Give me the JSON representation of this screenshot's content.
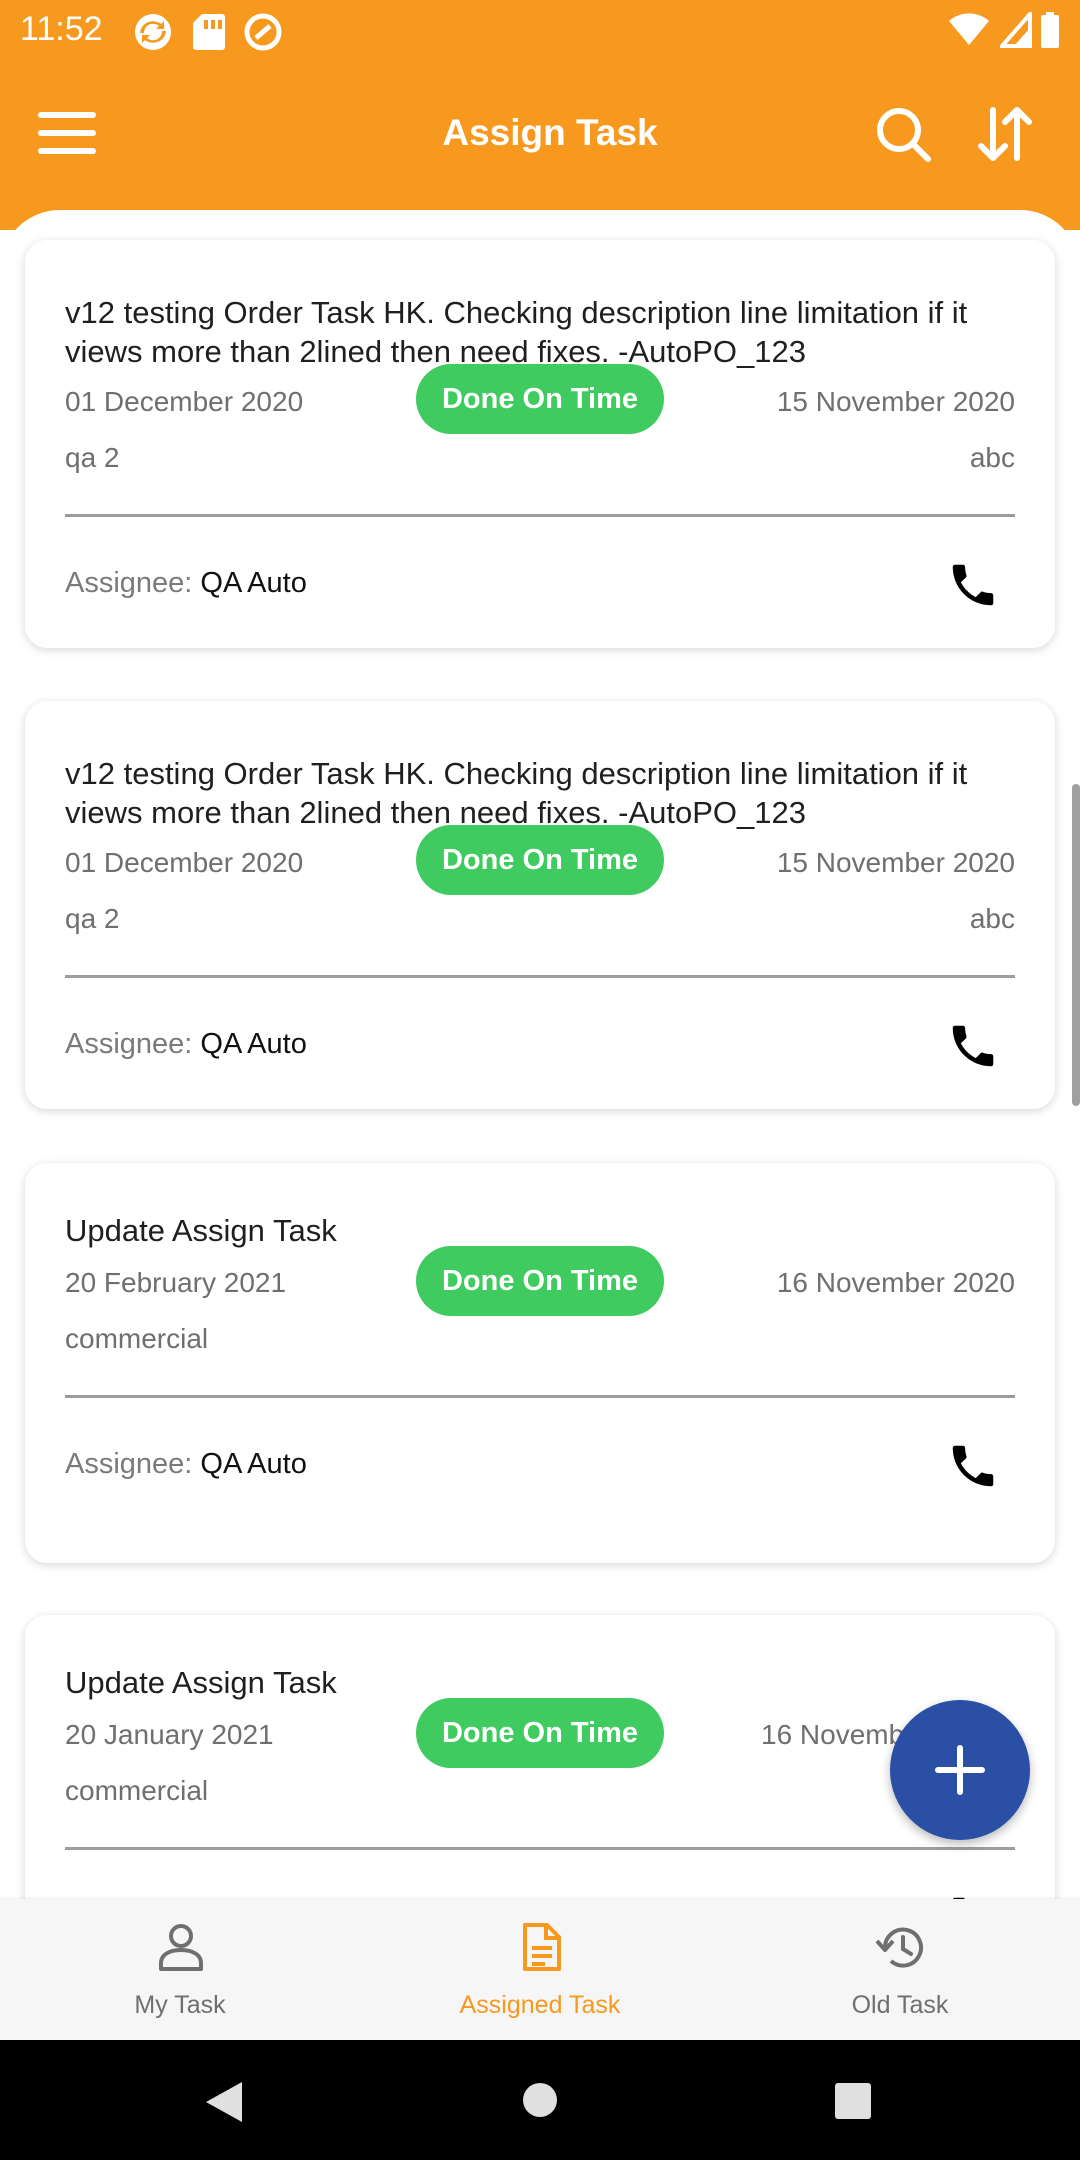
{
  "status_bar": {
    "time": "11:52"
  },
  "app_bar": {
    "title": "Assign Task"
  },
  "tasks": [
    {
      "description": "v12 testing Order Task HK. Checking description line limitation if it views more than 2lined then need fixes. -AutoPO_123",
      "start_date": "01 December 2020",
      "status": "Done On Time",
      "due_date": "15 November 2020",
      "category": "qa 2",
      "extra": "abc",
      "assignee_label": "Assignee:",
      "assignee_name": "QA Auto"
    },
    {
      "description": "v12 testing Order Task HK. Checking description line limitation if it views more than 2lined then need fixes. -AutoPO_123",
      "start_date": "01 December 2020",
      "status": "Done On Time",
      "due_date": "15 November 2020",
      "category": "qa 2",
      "extra": "abc",
      "assignee_label": "Assignee:",
      "assignee_name": "QA Auto"
    },
    {
      "description": "Update Assign Task",
      "start_date": "20 February 2021",
      "status": "Done On Time",
      "due_date": "16 November 2020",
      "category": "commercial",
      "assignee_label": "Assignee:",
      "assignee_name": "QA Auto"
    },
    {
      "description": "Update Assign Task",
      "start_date": "20 January 2021",
      "status": "Done On Time",
      "due_date": "16 Novemb",
      "category": "commercial"
    }
  ],
  "bottom_nav": {
    "items": [
      {
        "label": "My Task",
        "icon": "person-icon"
      },
      {
        "label": "Assigned Task",
        "icon": "document-icon"
      },
      {
        "label": "Old Task",
        "icon": "history-icon"
      }
    ]
  },
  "colors": {
    "primary": "#F7991F",
    "status_badge": "#3FCB5F",
    "fab": "#2A4FA5",
    "active_nav": "#F7991F",
    "inactive_nav": "#6f6f6f"
  }
}
